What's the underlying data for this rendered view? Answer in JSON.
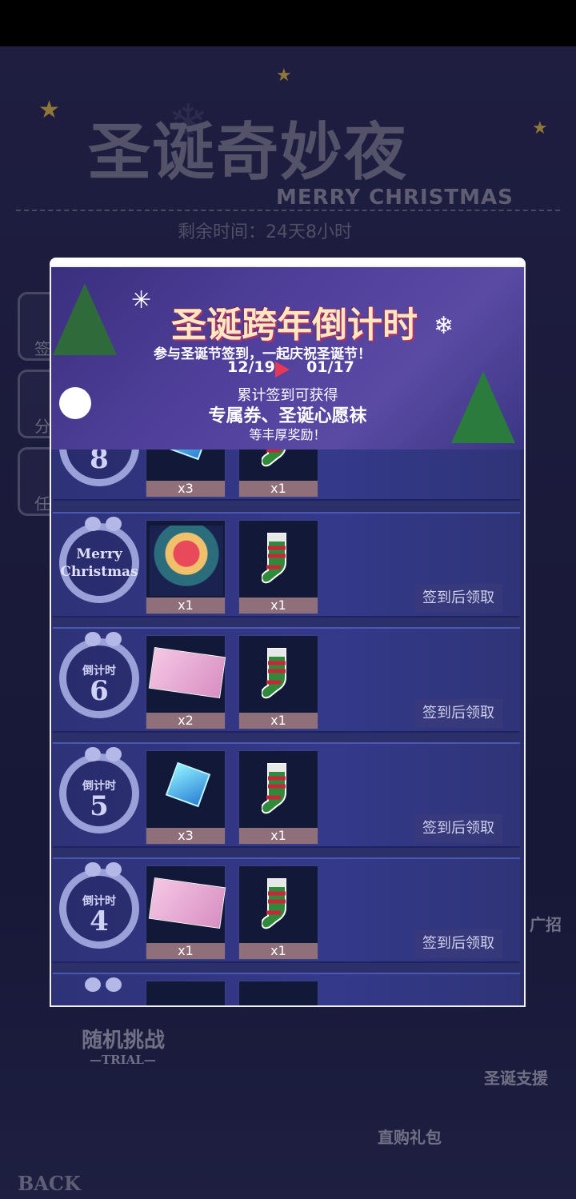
{
  "header": {
    "title_cn": "圣诞奇妙夜",
    "title_en": "MERRY CHRISTMAS",
    "remaining_label": "剩余时间：24天8小时"
  },
  "side_buttons": [
    "签",
    "分",
    "任"
  ],
  "bottom_buttons": {
    "trial_title": "随机挑战",
    "trial_sub": "—TRIAL—",
    "gift_pack": "直购礼包",
    "support": "圣诞支援",
    "recruit": "广招",
    "back": "BACK"
  },
  "banner": {
    "title": "圣诞跨年倒计时",
    "subtitle": "参与圣诞节签到，一起庆祝圣诞节！",
    "date_start": "12/19",
    "date_end": "01/17",
    "line1": "累计签到可获得",
    "line2": "专属券、圣诞心愿袜",
    "line3": "等丰厚奖励！"
  },
  "rows": [
    {
      "wreath_small": "",
      "wreath_num": "8",
      "merry": "",
      "items": [
        {
          "type": "cube",
          "count": "x3"
        },
        {
          "type": "sock",
          "count": "x1"
        }
      ],
      "claim": ""
    },
    {
      "wreath_small": "",
      "wreath_num": "",
      "merry": "Merry\nChristmas",
      "items": [
        {
          "type": "scene",
          "count": "x1"
        },
        {
          "type": "sock",
          "count": "x1"
        }
      ],
      "claim": "签到后领取"
    },
    {
      "wreath_small": "倒计时",
      "wreath_num": "6",
      "merry": "",
      "items": [
        {
          "type": "ticket",
          "count": "x2"
        },
        {
          "type": "sock",
          "count": "x1"
        }
      ],
      "claim": "签到后领取"
    },
    {
      "wreath_small": "倒计时",
      "wreath_num": "5",
      "merry": "",
      "items": [
        {
          "type": "cube",
          "count": "x3"
        },
        {
          "type": "sock",
          "count": "x1"
        }
      ],
      "claim": "签到后领取"
    },
    {
      "wreath_small": "倒计时",
      "wreath_num": "4",
      "merry": "",
      "items": [
        {
          "type": "ticket",
          "count": "x1"
        },
        {
          "type": "sock",
          "count": "x1"
        }
      ],
      "claim": "签到后领取"
    }
  ],
  "colors": {
    "accent": "#e8385a",
    "banner_text": "#fbe7c0",
    "claim_bg": "#3c3c78"
  }
}
